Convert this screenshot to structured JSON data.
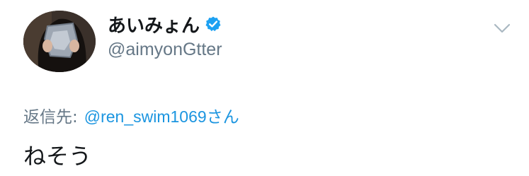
{
  "tweet": {
    "user": {
      "display_name": "あいみょん",
      "handle": "@aimyonGtter",
      "verified": true,
      "avatar_icon": "user-avatar-photo"
    },
    "menu_icon": "chevron-down-icon",
    "reply": {
      "label": "返信先:",
      "target": "@ren_swim1069",
      "suffix": "さん"
    },
    "text": "ねそう"
  },
  "colors": {
    "text_primary": "#14171a",
    "text_secondary": "#657786",
    "link": "#1b95e0",
    "verified_badge": "#1da1f2",
    "caret": "#aab8c2"
  }
}
